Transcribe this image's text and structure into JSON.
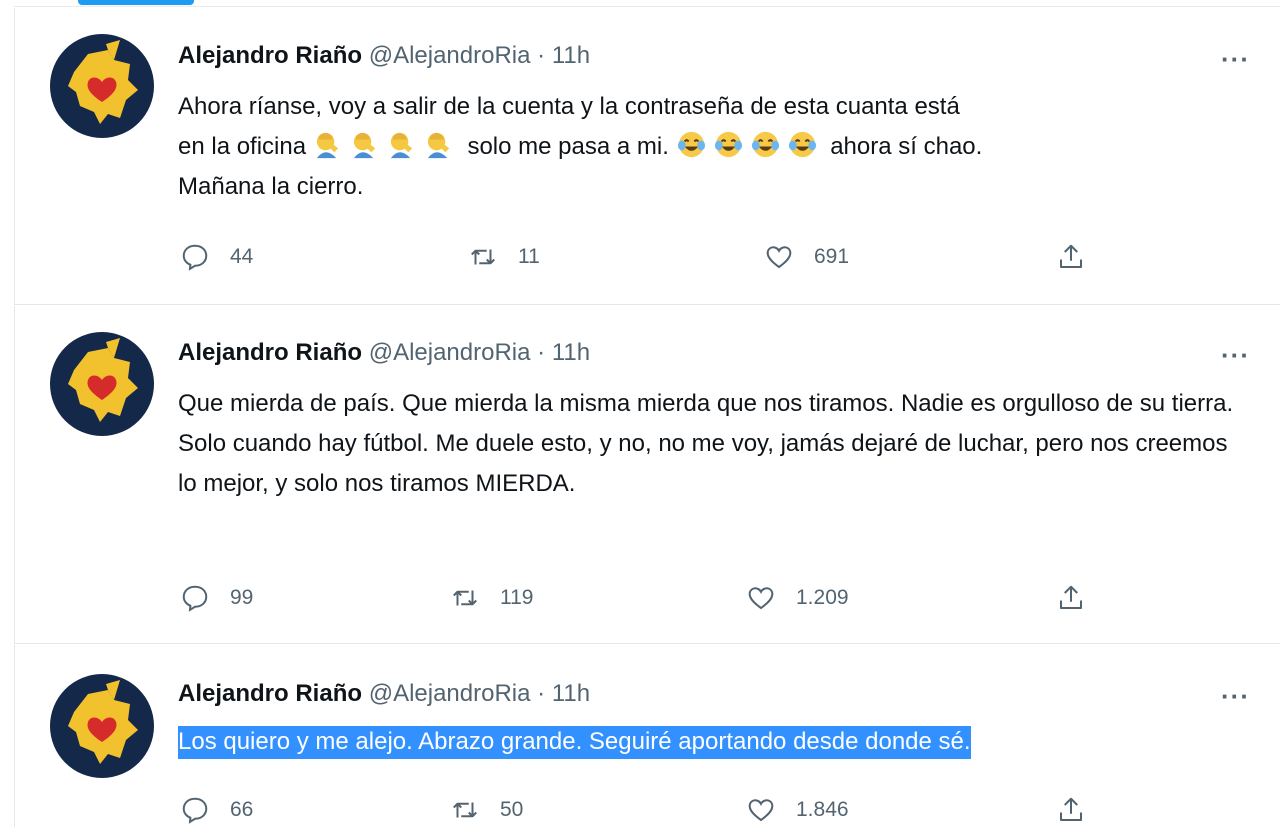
{
  "tweets": [
    {
      "author_name": "Alejandro Riaño",
      "author_handle": "@AlejandroRia",
      "separator": "·",
      "time": "11h",
      "more_label": "···",
      "text_line1": "Ahora ríanse, voy a salir de la cuenta y la contraseña de esta cuanta  está",
      "text_line2_start": "en la oficina",
      "text_line2_mid": "solo me pasa a mi.",
      "text_line2_end": "ahora sí chao.",
      "text_line3": "Mañana la cierro.",
      "emoji_group1": [
        "man-facepalming-emoji",
        "man-facepalming-emoji",
        "man-facepalming-emoji",
        "man-facepalming-emoji"
      ],
      "emoji_group2": [
        "face-with-tears-of-joy-emoji",
        "face-with-tears-of-joy-emoji",
        "face-with-tears-of-joy-emoji",
        "face-with-tears-of-joy-emoji"
      ],
      "replies": "44",
      "retweets": "11",
      "likes": "691"
    },
    {
      "author_name": "Alejandro Riaño",
      "author_handle": "@AlejandroRia",
      "separator": "·",
      "time": "11h",
      "more_label": "···",
      "text": "Que mierda de país. Que mierda la misma mierda que nos tiramos. Nadie es orgulloso de su tierra. Solo cuando hay fútbol. Me duele esto, y no, no me voy, jamás dejaré de luchar, pero nos creemos lo mejor, y solo nos tiramos MIERDA.",
      "replies": "99",
      "retweets": "119",
      "likes": "1.209"
    },
    {
      "author_name": "Alejandro Riaño",
      "author_handle": "@AlejandroRia",
      "separator": "·",
      "time": "11h",
      "more_label": "···",
      "text": "Los quiero y me alejo. Abrazo grande. Seguiré aportando desde donde sé.",
      "text_selected": true,
      "replies": "66",
      "retweets": "50",
      "likes": "1.846"
    }
  ],
  "icons": {
    "reply": "reply-icon",
    "retweet": "retweet-icon",
    "like": "heart-icon",
    "share": "share-icon",
    "avatar": "colombia-map-heart-avatar"
  },
  "colors": {
    "text_primary": "#0f1419",
    "text_secondary": "#536471",
    "avatar_bg": "#142849",
    "avatar_map": "#f2c12e",
    "avatar_heart": "#d62b2b",
    "selection": "#3390ff",
    "accent": "#1d9bf0"
  }
}
